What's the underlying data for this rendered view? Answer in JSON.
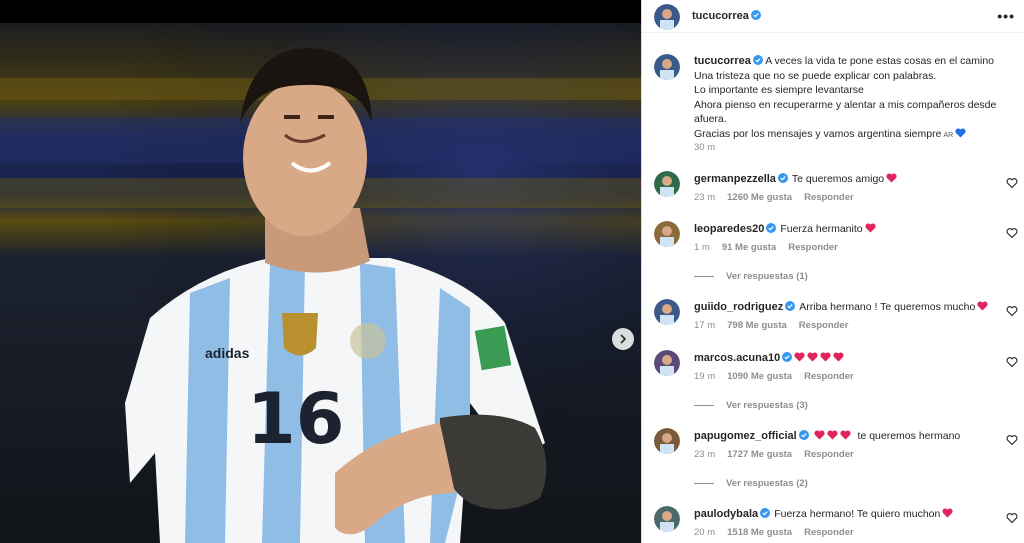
{
  "post": {
    "author": "tucucorrea",
    "verified": true,
    "header_more_icon": "more-horizontal-icon"
  },
  "caption": {
    "username": "tucucorrea",
    "lines": [
      "A veces la vida te pone estas cosas en el camino",
      "Una tristeza que no se puede explicar con palabras.",
      "Lo importante es siempre levantarse",
      "Ahora pienso en recuperarme y alentar a mis compañeros desde afuera.",
      "Gracias por los mensajes y vamos argentina siempre"
    ],
    "flag_label": "AR",
    "heart_color": "#1f6fe0",
    "time": "30 m"
  },
  "photo": {
    "jersey_number": "16",
    "brand_text": "adidas"
  },
  "comments": [
    {
      "username": "germanpezzella",
      "text": "Te queremos amigo",
      "hearts": 1,
      "time": "23 m",
      "likes": "1260 Me gusta",
      "reply": "Responder"
    },
    {
      "username": "leoparedes20",
      "text": "Fuerza hermanito",
      "hearts": 1,
      "time": "1 m",
      "likes": "91 Me gusta",
      "reply": "Responder",
      "replies": "Ver respuestas (1)"
    },
    {
      "username": "guiido_rodriguez",
      "text": "Arriba hermano ! Te queremos mucho",
      "hearts": 1,
      "time": "17 m",
      "likes": "798 Me gusta",
      "reply": "Responder"
    },
    {
      "username": "marcos.acuna10",
      "text": "",
      "hearts": 4,
      "time": "19 m",
      "likes": "1090 Me gusta",
      "reply": "Responder",
      "replies": "Ver respuestas (3)"
    },
    {
      "username": "papugomez_official",
      "text": "te queremos hermano",
      "hearts": 3,
      "hearts_before": true,
      "time": "23 m",
      "likes": "1727 Me gusta",
      "reply": "Responder",
      "replies": "Ver respuestas (2)"
    },
    {
      "username": "paulodybala",
      "text": "Fuerza hermano! Te quiero muchon",
      "hearts": 1,
      "time": "20 m",
      "likes": "1518 Me gusta",
      "reply": "Responder"
    }
  ],
  "colors": {
    "verified": "#3897f0",
    "heart_red": "#e0245e",
    "muted": "#8e8e8e"
  }
}
